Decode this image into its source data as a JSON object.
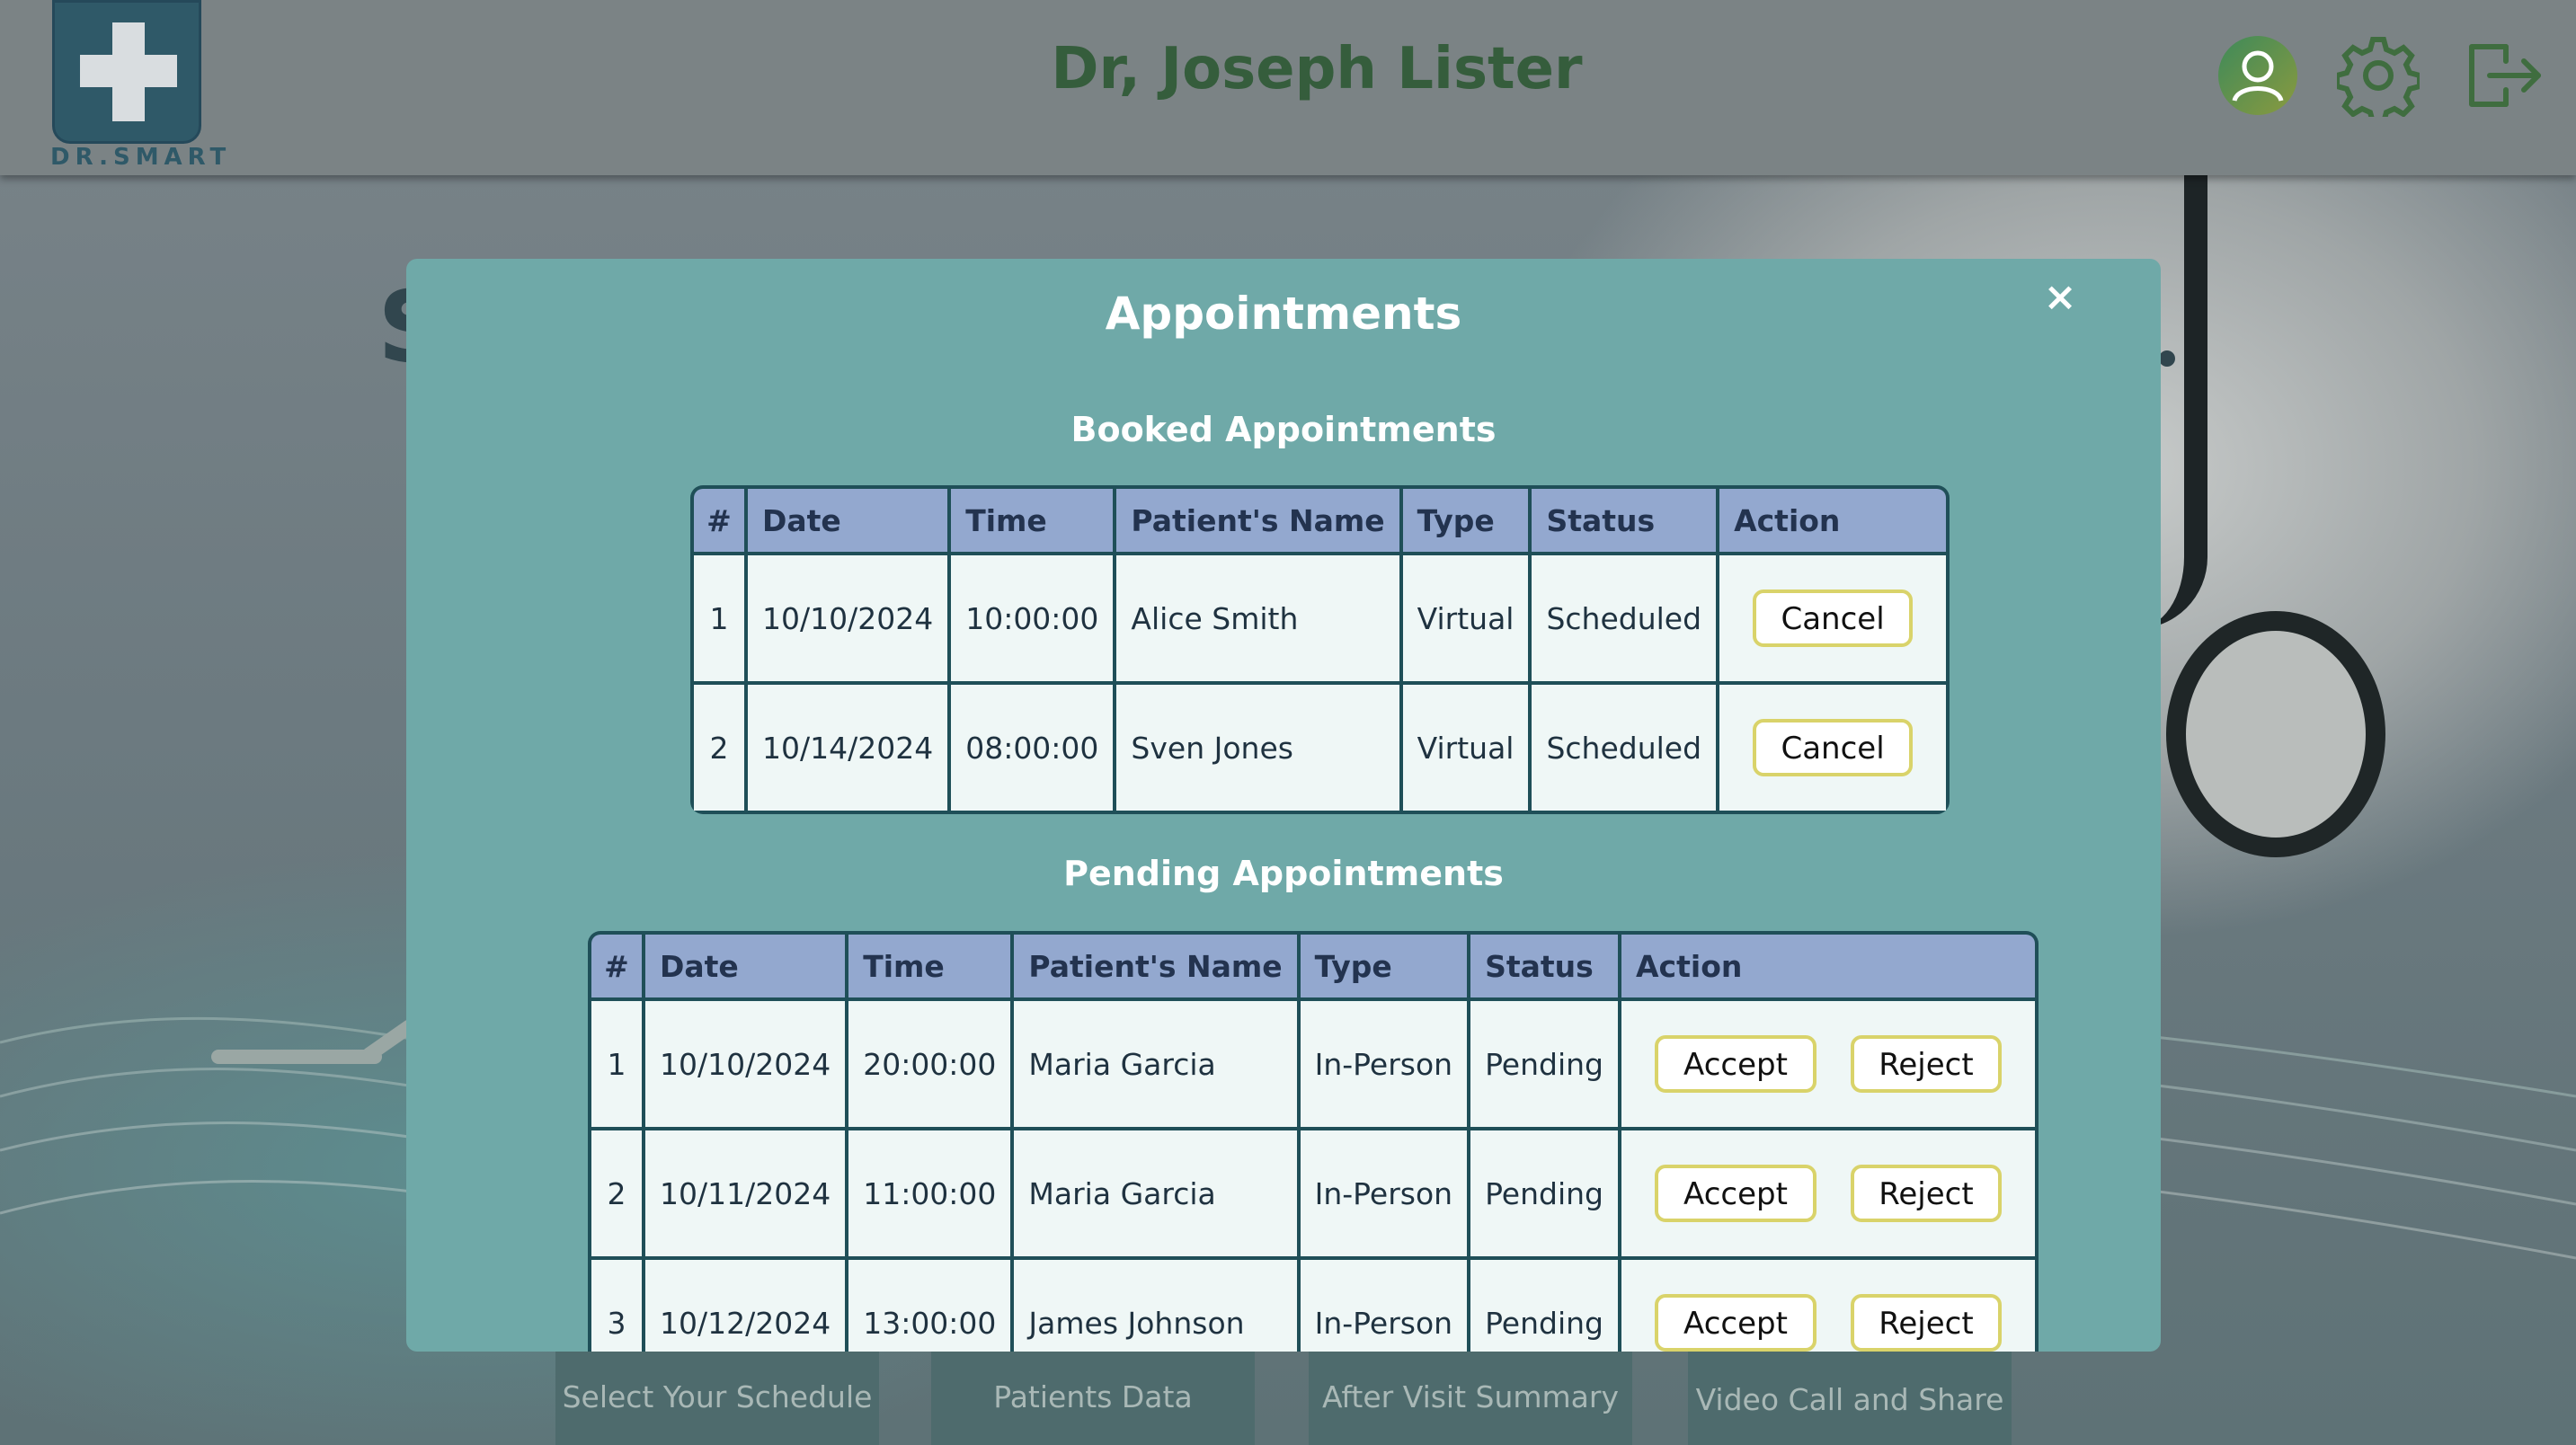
{
  "header": {
    "logo_text": "DR.SMART",
    "title": "Dr, Joseph Lister",
    "icons": [
      "user-icon",
      "settings-icon",
      "logout-icon"
    ],
    "title_color": "#355d3c"
  },
  "background": {
    "partial_heading_letter": "S"
  },
  "bottom_tabs": [
    {
      "label": "Select Your Schedule"
    },
    {
      "label": "Patients Data"
    },
    {
      "label": "After Visit Summary"
    },
    {
      "label": "Video Call and Share"
    }
  ],
  "modal": {
    "title": "Appointments",
    "close_symbol": "×",
    "booked": {
      "title": "Booked Appointments",
      "headers": [
        "#",
        "Date",
        "Time",
        "Patient's Name",
        "Type",
        "Status",
        "Action"
      ],
      "rows": [
        {
          "num": "1",
          "date": "10/10/2024",
          "time": "10:00:00",
          "name": "Alice Smith",
          "type": "Virtual",
          "status": "Scheduled",
          "action": "Cancel"
        },
        {
          "num": "2",
          "date": "10/14/2024",
          "time": "08:00:00",
          "name": "Sven Jones",
          "type": "Virtual",
          "status": "Scheduled",
          "action": "Cancel"
        }
      ]
    },
    "pending": {
      "title": "Pending Appointments",
      "headers": [
        "#",
        "Date",
        "Time",
        "Patient's Name",
        "Type",
        "Status",
        "Action"
      ],
      "rows": [
        {
          "num": "1",
          "date": "10/10/2024",
          "time": "20:00:00",
          "name": "Maria Garcia",
          "type": "In-Person",
          "status": "Pending",
          "accept": "Accept",
          "reject": "Reject"
        },
        {
          "num": "2",
          "date": "10/11/2024",
          "time": "11:00:00",
          "name": "Maria Garcia",
          "type": "In-Person",
          "status": "Pending",
          "accept": "Accept",
          "reject": "Reject"
        },
        {
          "num": "3",
          "date": "10/12/2024",
          "time": "13:00:00",
          "name": "James Johnson",
          "type": "In-Person",
          "status": "Pending",
          "accept": "Accept",
          "reject": "Reject"
        }
      ]
    }
  }
}
